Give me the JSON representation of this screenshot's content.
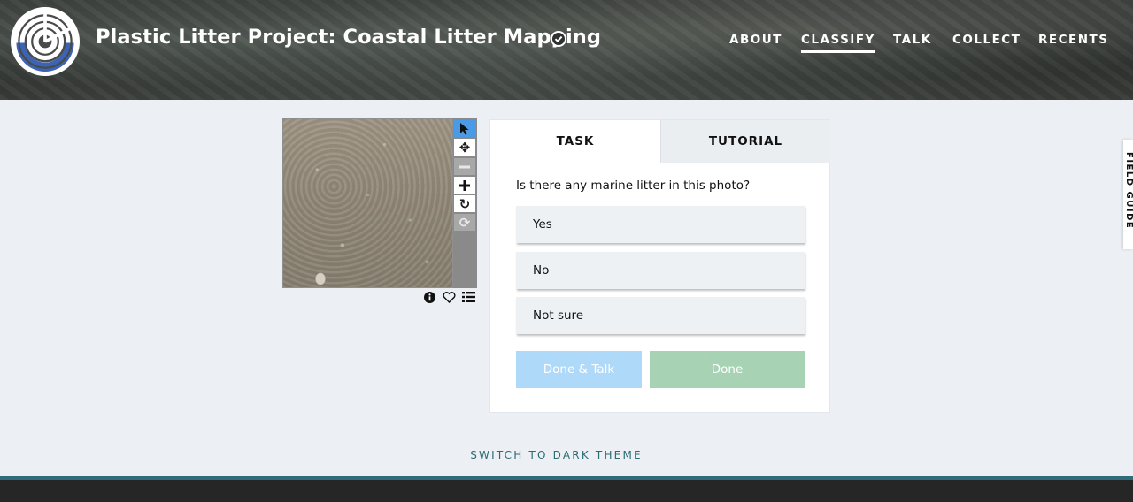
{
  "header": {
    "project_title": "Plastic Litter Project: Coastal Litter Mapping",
    "logo_icon": "project-logo-icon",
    "verified_icon": "check-circle-icon",
    "nav": [
      {
        "label": "ABOUT",
        "active": false
      },
      {
        "label": "CLASSIFY",
        "active": true
      },
      {
        "label": "TALK",
        "active": false
      },
      {
        "label": "COLLECT",
        "active": false
      },
      {
        "label": "RECENTS",
        "active": false
      }
    ]
  },
  "viewer": {
    "tools": [
      {
        "name": "pointer-icon",
        "glyph": "➤",
        "state": "selected"
      },
      {
        "name": "move-icon",
        "glyph": "✥",
        "state": "enabled"
      },
      {
        "name": "zoom-out-icon",
        "glyph": "−",
        "state": "disabled"
      },
      {
        "name": "zoom-in-icon",
        "glyph": "+",
        "state": "enabled"
      },
      {
        "name": "rotate-icon",
        "glyph": "↻",
        "state": "enabled"
      },
      {
        "name": "reset-icon",
        "glyph": "⟳",
        "state": "disabled"
      }
    ],
    "meta_icons": [
      "info-icon",
      "heart-icon",
      "list-icon"
    ]
  },
  "task": {
    "tabs": {
      "task": "TASK",
      "tutorial": "TUTORIAL"
    },
    "question": "Is there any marine litter in this photo?",
    "answers": [
      "Yes",
      "No",
      "Not sure"
    ],
    "buttons": {
      "done_talk": "Done & Talk",
      "done": "Done"
    }
  },
  "field_guide": {
    "label": "FIELD GUIDE"
  },
  "theme_switch": "SWITCH TO DARK THEME",
  "colors": {
    "accent_blue": "#4a9ae6",
    "done_talk_bg": "#afd9f8",
    "done_bg": "#a7d3b4",
    "link_teal": "#2b6b73",
    "footer_bar": "#2f6d7a",
    "footer": "#262626"
  }
}
